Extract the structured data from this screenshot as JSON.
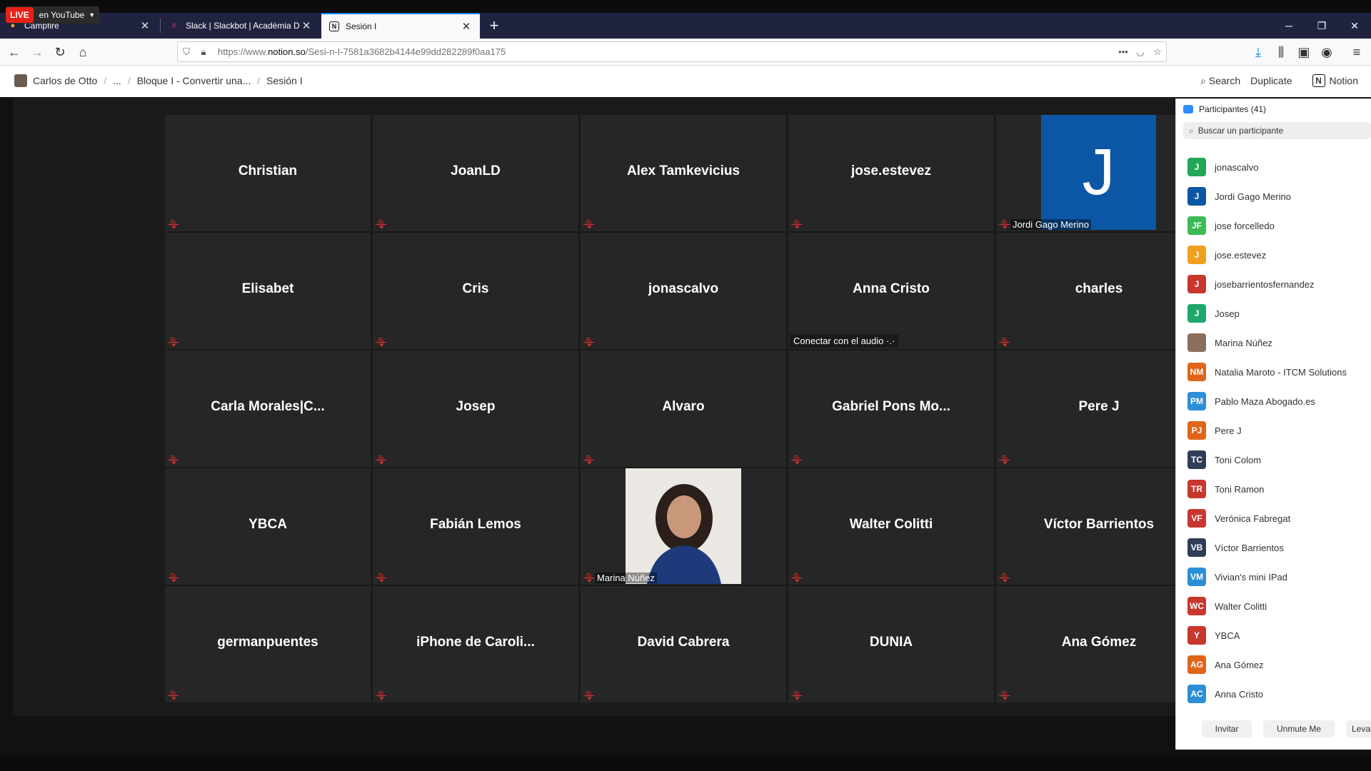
{
  "live_badge": {
    "live": "LIVE",
    "text": "en YouTube"
  },
  "tabs": [
    {
      "title": "Campfire",
      "icon": "campfire-icon",
      "active": false
    },
    {
      "title": "Slack | Slackbot | Acadèmia Dig",
      "icon": "slack-icon",
      "active": false
    },
    {
      "title": "Sesión I",
      "icon": "notion-icon",
      "active": true
    }
  ],
  "url": {
    "prefix": "https://www.",
    "domain": "notion.so",
    "path": "/Sesi-n-I-7581a3682b4144e99dd282289f0aa175"
  },
  "breadcrumb": [
    "Carlos de Otto",
    "...",
    "Bloque I - Convertir una...",
    "Sesión I"
  ],
  "notion_actions": {
    "search": "Search",
    "duplicate": "Duplicate",
    "notion": "Notion"
  },
  "tiles": [
    {
      "name": "Christian"
    },
    {
      "name": "JoanLD"
    },
    {
      "name": "Alex Tamkevicius"
    },
    {
      "name": "jose.estevez"
    },
    {
      "name": "",
      "label": "Jordi Gago Merino",
      "video": "J"
    },
    {
      "name": "Elisabet"
    },
    {
      "name": "Cris"
    },
    {
      "name": "jonascalvo"
    },
    {
      "name": "Anna Cristo",
      "audio": "Conectar con el audio ·.·"
    },
    {
      "name": "charles"
    },
    {
      "name": "Carla  Morales|C..."
    },
    {
      "name": "Josep"
    },
    {
      "name": "Alvaro"
    },
    {
      "name": "Gabriel  Pons  Mo..."
    },
    {
      "name": "Pere J"
    },
    {
      "name": "YBCA"
    },
    {
      "name": "Fabián Lemos"
    },
    {
      "name": "",
      "label": "Marina Núñez",
      "video": "photo"
    },
    {
      "name": "Walter Colitti"
    },
    {
      "name": "Víctor Barrientos"
    },
    {
      "name": "germanpuentes"
    },
    {
      "name": "iPhone  de  Caroli..."
    },
    {
      "name": "David Cabrera"
    },
    {
      "name": "DUNIA"
    },
    {
      "name": "Ana Gómez"
    }
  ],
  "panel": {
    "title": "Participantes (41)",
    "search_placeholder": "Buscar un participante",
    "participants": [
      {
        "initials": "J",
        "name": "jonascalvo",
        "color": "#23a55a"
      },
      {
        "initials": "J",
        "name": "Jordi Gago Merino",
        "color": "#0b57a5"
      },
      {
        "initials": "JF",
        "name": "jose forcelledo",
        "color": "#3cba54"
      },
      {
        "initials": "J",
        "name": "jose.estevez",
        "color": "#f0a020"
      },
      {
        "initials": "J",
        "name": "josebarrientosfernandez",
        "color": "#c8372d"
      },
      {
        "initials": "J",
        "name": "Josep",
        "color": "#1fa86b"
      },
      {
        "initials": "",
        "name": "Marina Núñez",
        "color": "#8a6f5c"
      },
      {
        "initials": "NM",
        "name": "Natalia Maroto - ITCM Solutions",
        "color": "#e06518"
      },
      {
        "initials": "PM",
        "name": "Pablo Maza Abogado.es",
        "color": "#2c8fd6"
      },
      {
        "initials": "PJ",
        "name": "Pere J",
        "color": "#e06518"
      },
      {
        "initials": "TC",
        "name": "Toni Colom",
        "color": "#2f3e56"
      },
      {
        "initials": "TR",
        "name": "Toni Ramon",
        "color": "#c8372d"
      },
      {
        "initials": "VF",
        "name": "Verónica Fabregat",
        "color": "#c8372d"
      },
      {
        "initials": "VB",
        "name": "Víctor Barrientos",
        "color": "#2f3e56"
      },
      {
        "initials": "VM",
        "name": "Vivian's mini IPad",
        "color": "#2c8fd6"
      },
      {
        "initials": "WC",
        "name": "Walter Colitti",
        "color": "#c8372d"
      },
      {
        "initials": "Y",
        "name": "YBCA",
        "color": "#c8372d"
      },
      {
        "initials": "AG",
        "name": "Ana Gómez",
        "color": "#e06518"
      },
      {
        "initials": "AC",
        "name": "Anna Cristo",
        "color": "#2c8fd6"
      }
    ],
    "buttons": {
      "invite": "Invitar",
      "unmute": "Unmute Me",
      "raise": "Levantar"
    }
  }
}
